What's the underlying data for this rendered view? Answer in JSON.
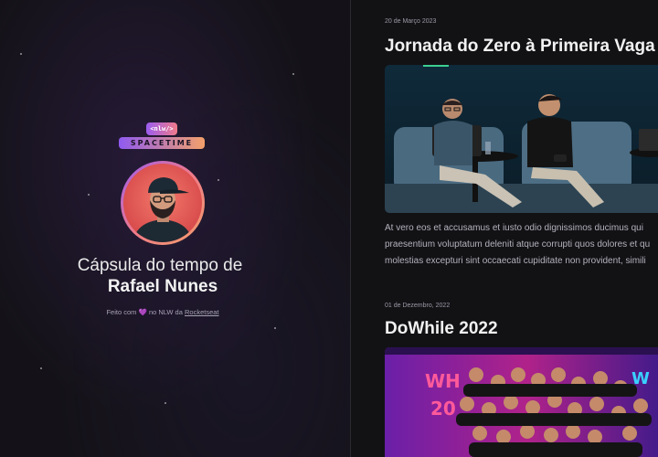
{
  "profile": {
    "logo_code": "<nlw/>",
    "logo_word": "SPACETIME",
    "title_prefix": "Cápsula do tempo de",
    "user_name": "Rafael Nunes"
  },
  "footer": {
    "made_with": "Feito com",
    "heart": "💜",
    "middle": "no NLW da",
    "link": "Rocketseat"
  },
  "memories": [
    {
      "date": "20 de Março 2023",
      "title": "Jornada do Zero à Primeira Vaga",
      "lines": [
        "At vero eos et accusamus et iusto odio dignissimos ducimus qui",
        "praesentium voluptatum deleniti atque corrupti quos dolores et qu",
        "molestias excepturi sint occaecati cupiditate non provident, simili"
      ]
    },
    {
      "date": "01 de Dezembro, 2022",
      "title": "DoWhile 2022",
      "lines": []
    }
  ],
  "colors": {
    "accent_purple": "#9b5df0",
    "accent_orange": "#f3a06a",
    "accent_green": "#3ccf91",
    "background": "#121215"
  }
}
